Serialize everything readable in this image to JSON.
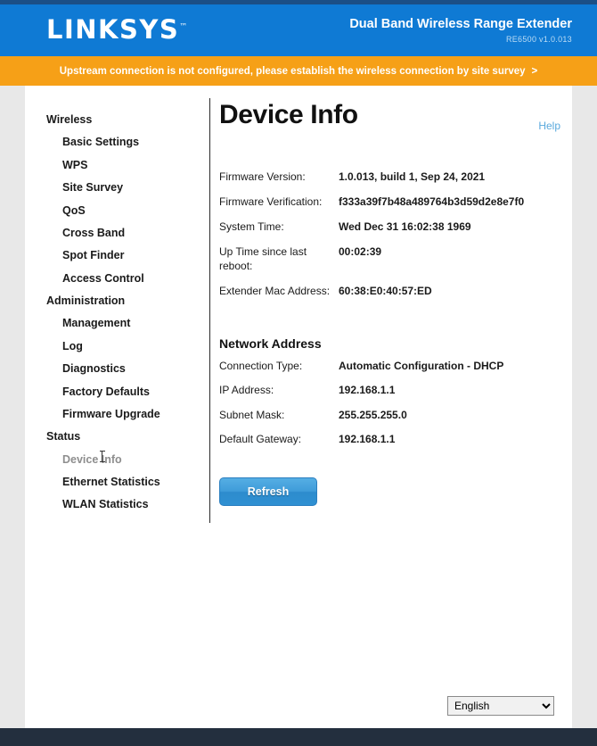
{
  "header": {
    "logo_text": "LINKSYS",
    "trademark": "™",
    "product_name": "Dual Band Wireless Range Extender",
    "model_version": "RE6500  v1.0.013"
  },
  "banner": {
    "message": "Upstream connection is not configured, please establish the wireless connection by site survey",
    "arrow": ">"
  },
  "sidebar": {
    "groups": [
      {
        "label": "Wireless",
        "items": [
          {
            "label": "Basic Settings"
          },
          {
            "label": "WPS"
          },
          {
            "label": "Site Survey"
          },
          {
            "label": "QoS"
          },
          {
            "label": "Cross Band"
          },
          {
            "label": "Spot Finder"
          },
          {
            "label": "Access Control"
          }
        ]
      },
      {
        "label": "Administration",
        "items": [
          {
            "label": "Management"
          },
          {
            "label": "Log"
          },
          {
            "label": "Diagnostics"
          },
          {
            "label": "Factory Defaults"
          },
          {
            "label": "Firmware Upgrade"
          }
        ]
      },
      {
        "label": "Status",
        "items": [
          {
            "label": "Device Info"
          },
          {
            "label": "Ethernet Statistics"
          },
          {
            "label": "WLAN Statistics"
          }
        ]
      }
    ]
  },
  "main": {
    "title": "Device Info",
    "help_label": "Help",
    "device_info": [
      {
        "label": "Firmware Version:",
        "value": "1.0.013, build 1, Sep 24, 2021"
      },
      {
        "label": "Firmware Verification:",
        "value": "f333a39f7b48a489764b3d59d2e8e7f0"
      },
      {
        "label": "System Time:",
        "value": "Wed Dec 31 16:02:38 1969"
      },
      {
        "label": "Up Time since last reboot:",
        "value": "00:02:39"
      },
      {
        "label": "Extender Mac Address:",
        "value": "60:38:E0:40:57:ED"
      }
    ],
    "network_section_title": "Network Address",
    "network_address": [
      {
        "label": "Connection Type:",
        "value": "Automatic Configuration - DHCP"
      },
      {
        "label": "IP Address:",
        "value": "192.168.1.1"
      },
      {
        "label": "Subnet Mask:",
        "value": "255.255.255.0"
      },
      {
        "label": "Default Gateway:",
        "value": "192.168.1.1"
      }
    ],
    "refresh_label": "Refresh"
  },
  "footer": {
    "language_selected": "English",
    "language_options": [
      "English"
    ]
  },
  "colors": {
    "header_blue": "#0f7ad4",
    "banner_orange": "#f6a017",
    "button_blue": "#3f9cd9",
    "help_link": "#5aa9dd",
    "footer_dark": "#232f3e"
  }
}
